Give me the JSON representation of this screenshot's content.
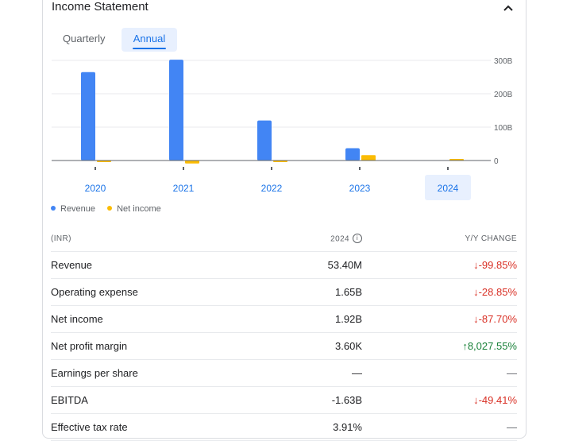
{
  "title": "Income Statement",
  "tabs": {
    "quarterly": "Quarterly",
    "annual": "Annual"
  },
  "legend": [
    {
      "label": "Revenue",
      "color": "#4285f4"
    },
    {
      "label": "Net income",
      "color": "#fbbc04"
    }
  ],
  "chart_data": {
    "type": "bar",
    "categories": [
      "2020",
      "2021",
      "2022",
      "2023",
      "2024"
    ],
    "selected_category": "2024",
    "series": [
      {
        "name": "Revenue",
        "color": "#4285f4",
        "values": [
          265,
          302,
          120,
          37,
          0.0534
        ]
      },
      {
        "name": "Net income",
        "color": "#fbbc04",
        "values": [
          -2,
          -9,
          -2,
          16,
          1.92
        ]
      }
    ],
    "y_ticks": [
      "0",
      "100B",
      "200B",
      "300B"
    ],
    "ylim": [
      -10,
      310
    ],
    "grid": true,
    "legend_position": "bottom-left"
  },
  "table": {
    "headers": {
      "label": "(INR)",
      "year": "2024",
      "change": "Y/Y CHANGE"
    },
    "rows": [
      {
        "label": "Revenue",
        "value": "53.40M",
        "change": "-99.85%",
        "trend": "down"
      },
      {
        "label": "Operating expense",
        "value": "1.65B",
        "change": "-28.85%",
        "trend": "down"
      },
      {
        "label": "Net income",
        "value": "1.92B",
        "change": "-87.70%",
        "trend": "down"
      },
      {
        "label": "Net profit margin",
        "value": "3.60K",
        "change": "8,027.55%",
        "trend": "up"
      },
      {
        "label": "Earnings per share",
        "value": "—",
        "change": "—",
        "trend": "flat"
      },
      {
        "label": "EBITDA",
        "value": "-1.63B",
        "change": "-49.41%",
        "trend": "down"
      },
      {
        "label": "Effective tax rate",
        "value": "3.91%",
        "change": "—",
        "trend": "flat"
      }
    ]
  }
}
